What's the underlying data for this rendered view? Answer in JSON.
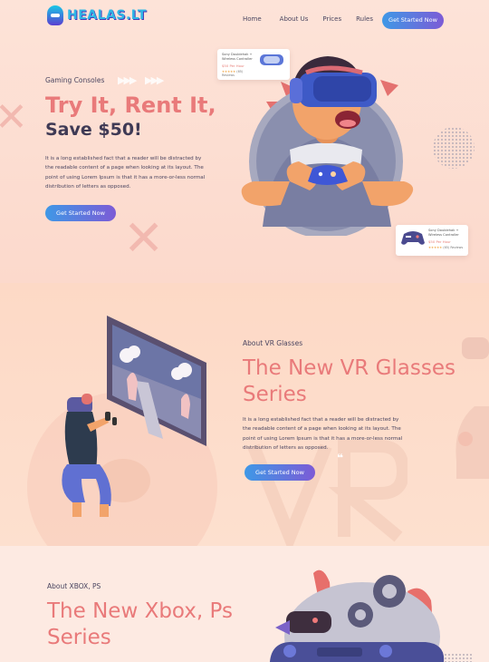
{
  "header": {
    "logo_text": "HEALAS.LT",
    "nav": [
      "Home",
      "About Us",
      "Prices",
      "Rules"
    ],
    "cta_label": "Get Started Now"
  },
  "hero": {
    "kicker": "Gaming Consoles",
    "title": "Try It, Rent It,",
    "subtitle": "Save $50!",
    "paragraph": [
      "It is a long established fact that a reader will be distracted by",
      "the readable content of a page when looking at its layout. The",
      "point of using Lorem Ipsum is that it has a more-or-less normal",
      "distribution of letters as opposed."
    ],
    "cta_label": "Get Started Now",
    "card_top": {
      "title_line1": "Sony Doublehak +",
      "title_line2": "Wireless Controller",
      "price": "$50 Per Hour",
      "stars": "★★★★★",
      "reviews": "(65) Reviews"
    },
    "card_bottom": {
      "title_line1": "Sony Doublehak +",
      "title_line2": "Wireless Controller",
      "price": "$50 Per Hour",
      "stars": "★★★★★",
      "reviews": "(65) Reviews"
    }
  },
  "vr": {
    "kicker": "About VR Glasses",
    "title_line1": "The New VR Glasses",
    "title_line2": "Series",
    "paragraph": [
      "It is a long established fact that a reader will be distracted by",
      "the readable content of a page when looking at its layout. The",
      "point of using Lorem Ipsum is that it has a more-or-less normal",
      "distribution of letters as opposed."
    ],
    "cta_label": "Get Started Now"
  },
  "xbox": {
    "kicker": "About XBOX, PS",
    "title_line1": "The New Xbox, Ps",
    "title_line2": "Series"
  },
  "colors": {
    "accent": "#e97a7a",
    "button_start": "#3f98e6",
    "button_end": "#7c5bd6",
    "headset": "#3f5bc4"
  }
}
